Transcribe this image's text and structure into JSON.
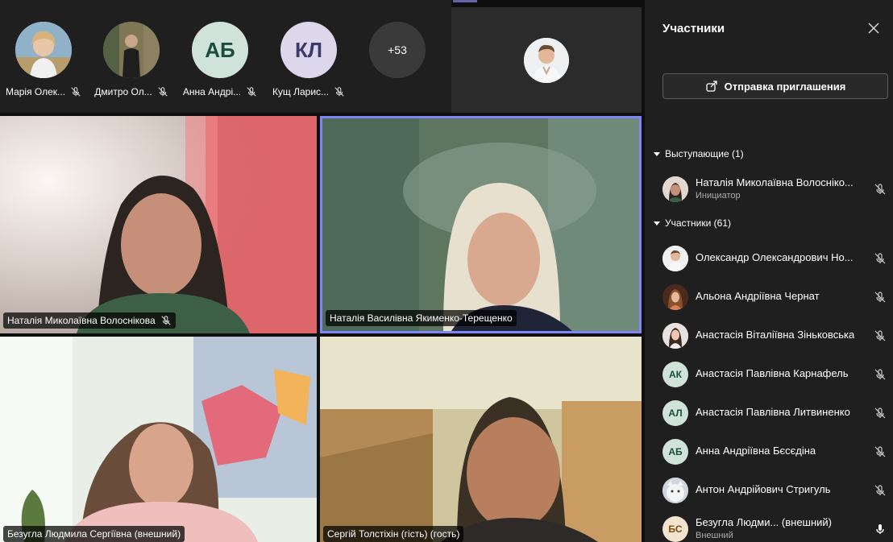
{
  "top_thumbnails": [
    {
      "name": "Марія Олек...",
      "initials": ""
    },
    {
      "name": "Дмитро Ол...",
      "initials": ""
    },
    {
      "name": "Анна Андрі...",
      "initials": "АБ"
    },
    {
      "name": "Кущ Ларис...",
      "initials": "КЛ"
    }
  ],
  "overflow_count": "+53",
  "video_tiles": [
    {
      "label": "Наталія Миколаївна Волоснікова"
    },
    {
      "label": "Наталія Василівна Якименко-Терещенко"
    },
    {
      "label": "Безугла Людмила Сергіївна (внешний)"
    },
    {
      "label": "Сергій Толстіхін (гість) (гость)"
    }
  ],
  "panel": {
    "title": "Участники",
    "invite_label": "Отправка приглашения",
    "presenters_header": "Выступающие (1)",
    "attendees_header": "Участники (61)",
    "presenters": [
      {
        "name": "Наталія Миколаївна Волосніко...",
        "sub": "Инициатор",
        "initials": ""
      }
    ],
    "attendees": [
      {
        "name": "Олександр Олександрович Но...",
        "initials": "",
        "sub": ""
      },
      {
        "name": "Альона Андріївна Чернат",
        "initials": "",
        "sub": ""
      },
      {
        "name": "Анастасія Віталіївна Зіньковська",
        "initials": "",
        "sub": ""
      },
      {
        "name": "Анастасія Павлівна Карнафель",
        "initials": "АК",
        "sub": ""
      },
      {
        "name": "Анастасія Павлівна Литвиненко",
        "initials": "АЛ",
        "sub": ""
      },
      {
        "name": "Анна Андріївна Бєсєдіна",
        "initials": "АБ",
        "sub": ""
      },
      {
        "name": "Антон Андрійович Стригуль",
        "initials": "",
        "sub": ""
      },
      {
        "name": "Безугла Людми...  (внешний)",
        "initials": "БС",
        "sub": "Внешний"
      }
    ]
  },
  "colors": {
    "accent": "#6264a7",
    "panel_bg": "#1f1f1f",
    "avatar_green_bg": "#cfe3db",
    "avatar_green_fg": "#1b4d3e"
  }
}
